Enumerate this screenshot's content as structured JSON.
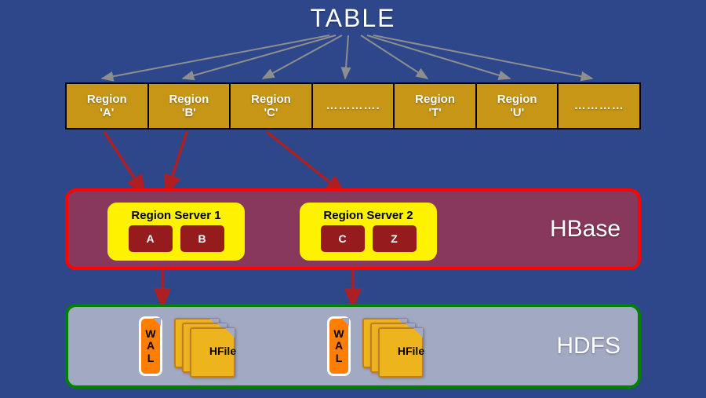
{
  "title": "TABLE",
  "regions": [
    {
      "line1": "Region",
      "line2": "'A'"
    },
    {
      "line1": "Region",
      "line2": "'B'"
    },
    {
      "line1": "Region",
      "line2": "'C'"
    },
    {
      "line1": "…………."
    },
    {
      "line1": "Region",
      "line2": "'T'"
    },
    {
      "line1": "Region",
      "line2": "'U'"
    },
    {
      "line1": "…………"
    }
  ],
  "hbase": {
    "label": "HBase",
    "servers": [
      {
        "title": "Region Server 1",
        "boxes": [
          "A",
          "B"
        ]
      },
      {
        "title": "Region Server 2",
        "boxes": [
          "C",
          "Z"
        ]
      }
    ]
  },
  "hdfs": {
    "label": "HDFS",
    "wal": "WAL",
    "hfile": "HFile"
  }
}
